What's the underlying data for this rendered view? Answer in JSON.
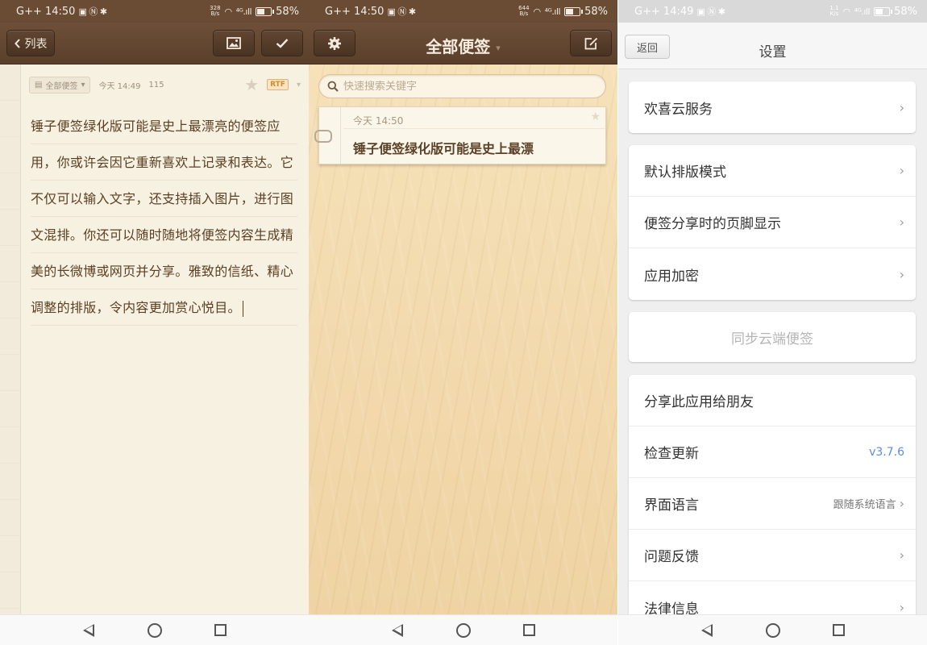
{
  "status_bars": [
    {
      "left": "G++ 14:50",
      "speed_top": "328",
      "speed_bottom": "B/s",
      "signal": "⁴ᴳ.ıll",
      "battery": "58%",
      "battery_level": 0.58
    },
    {
      "left": "G++ 14:50",
      "speed_top": "644",
      "speed_bottom": "B/s",
      "signal": "⁴ᴳ.ıll",
      "battery": "58%",
      "battery_level": 0.58
    },
    {
      "left": "G++ 14:49",
      "speed_top": "1.1",
      "speed_bottom": "K/s",
      "signal": "⁴ᴳ.ıll",
      "battery": "58%",
      "battery_level": 0.58
    }
  ],
  "editor": {
    "back_label": "列表",
    "folder": "全部便签",
    "time": "今天 14:49",
    "count": "115",
    "badge": "RTF",
    "body": "锤子便签绿化版可能是史上最漂亮的便签应用，你或许会因它重新喜欢上记录和表达。它不仅可以输入文字，还支持插入图片，进行图文混排。你还可以随时随地将便签内容生成精美的长微博或网页并分享。雅致的信纸、精心调整的排版，令内容更加赏心悦目。"
  },
  "list": {
    "title": "全部便签",
    "search_placeholder": "快速搜索关键字",
    "notes": [
      {
        "date": "今天 14:50",
        "title": "锤子便签绿化版可能是史上最漂"
      }
    ]
  },
  "settings": {
    "back_label": "返回",
    "title": "设置",
    "cloud_service": "欢喜云服务",
    "default_layout": "默认排版模式",
    "share_footer": "便签分享时的页脚显示",
    "app_lock": "应用加密",
    "sync": "同步云端便签",
    "share_app": "分享此应用给朋友",
    "check_update": "检查更新",
    "version": "v3.7.6",
    "language": "界面语言",
    "language_value": "跟随系统语言",
    "feedback": "问题反馈",
    "legal": "法律信息"
  },
  "colors": {
    "brown_bar": "#6a4c35",
    "wood": "#f0d9ad",
    "paper": "#f7f1e2",
    "note_text": "#5a3f22",
    "version_blue": "#5b8fd6"
  },
  "icons": {
    "back": "chevron-left-icon",
    "image": "image-icon",
    "confirm": "check-icon",
    "settings": "gear-icon",
    "compose": "compose-icon",
    "search": "search-icon",
    "star": "star-icon",
    "chevron": "chevron-right-icon",
    "paperclip": "paperclip-icon"
  }
}
